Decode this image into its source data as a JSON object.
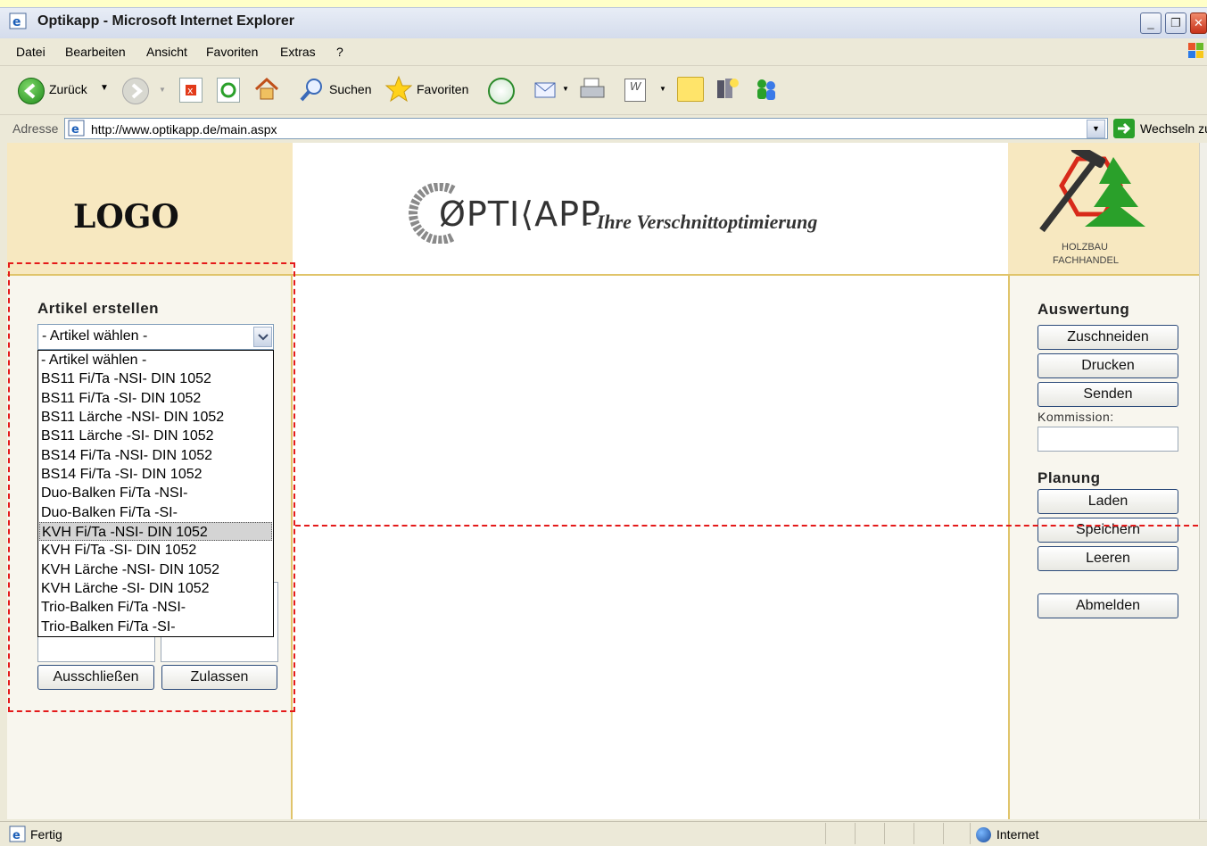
{
  "window": {
    "title": "Optikapp - Microsoft Internet Explorer"
  },
  "menu": [
    "Datei",
    "Bearbeiten",
    "Ansicht",
    "Favoriten",
    "Extras",
    "?"
  ],
  "toolbar": {
    "back_label": "Zurück",
    "search_label": "Suchen",
    "favorites_label": "Favoriten"
  },
  "address": {
    "label": "Adresse",
    "url": "http://www.optikapp.de/main.aspx",
    "go_label": "Wechseln zu"
  },
  "header": {
    "logo_placeholder": "LOGO",
    "brand_name": "ØPTI⟨APP",
    "brand_tagline": "- Ihre Verschnittoptimierung",
    "partner_line1": "HOLZBAU",
    "partner_line2": "FACHHANDEL"
  },
  "left_panel": {
    "title": "Artikel erstellen",
    "select_value": "- Artikel wählen -",
    "options": [
      "- Artikel wählen -",
      "BS11 Fi/Ta -NSI- DIN 1052",
      "BS11 Fi/Ta -SI- DIN 1052",
      "BS11 Lärche -NSI- DIN 1052",
      "BS11 Lärche -SI- DIN 1052",
      "BS14 Fi/Ta -NSI- DIN 1052",
      "BS14 Fi/Ta -SI- DIN 1052",
      "Duo-Balken Fi/Ta -NSI-",
      "Duo-Balken Fi/Ta -SI-",
      "KVH Fi/Ta -NSI- DIN 1052",
      "KVH Fi/Ta -SI- DIN 1052",
      "KVH Lärche -NSI- DIN 1052",
      "KVH Lärche -SI- DIN 1052",
      "Trio-Balken Fi/Ta -NSI-",
      "Trio-Balken Fi/Ta -SI-"
    ],
    "highlighted_option": "KVH Fi/Ta -NSI- DIN 1052",
    "exclude_label": "Ausschließen",
    "allow_label": "Zulassen"
  },
  "right_panel": {
    "evaluation_title": "Auswertung",
    "cut_label": "Zuschneiden",
    "print_label": "Drucken",
    "send_label": "Senden",
    "commission_label": "Kommission:",
    "commission_value": "",
    "planning_title": "Planung",
    "load_label": "Laden",
    "save_label": "Speichern",
    "clear_label": "Leeren",
    "logout_label": "Abmelden"
  },
  "status": {
    "text": "Fertig",
    "zone": "Internet"
  },
  "colors": {
    "header_bg": "#f7e8c0",
    "accent_line": "#e0c46a",
    "annotation_dash": "#e41a1a",
    "selected_option": "#d4d4d4"
  }
}
